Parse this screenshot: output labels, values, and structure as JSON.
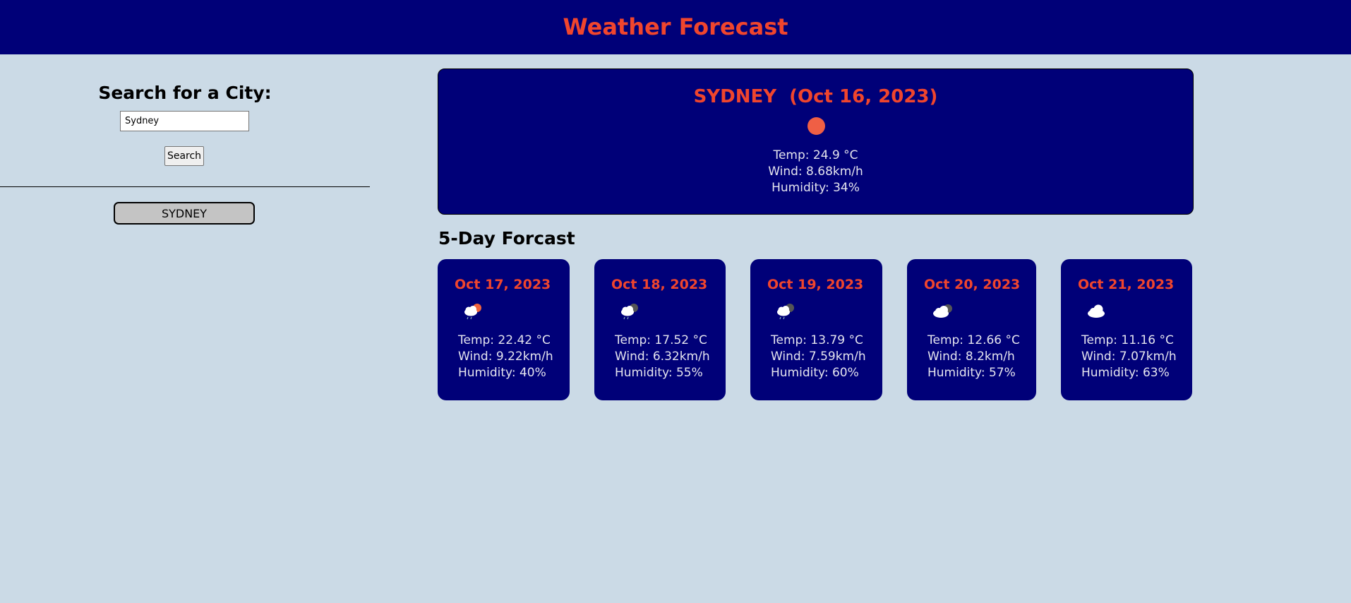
{
  "header": {
    "title": "Weather Forecast"
  },
  "sidebar": {
    "heading": "Search for a City:",
    "search_value": "Sydney",
    "search_button": "Search",
    "history": [
      "SYDNEY"
    ]
  },
  "current": {
    "title": "SYDNEY  (Oct 16, 2023)",
    "icon": "sun-icon",
    "temp": "Temp: 24.9 °C",
    "wind": "Wind: 8.68km/h",
    "humidity": "Humidity: 34%"
  },
  "forecast_heading": "5-Day Forcast",
  "forecast": [
    {
      "date": "Oct 17, 2023",
      "icon": "sun-behind-rain-cloud-icon",
      "temp": "Temp: 22.42 °C",
      "wind": "Wind: 9.22km/h",
      "humidity": "Humidity: 40%"
    },
    {
      "date": "Oct 18, 2023",
      "icon": "moon-behind-rain-cloud-icon",
      "temp": "Temp: 17.52 °C",
      "wind": "Wind: 6.32km/h",
      "humidity": "Humidity: 55%"
    },
    {
      "date": "Oct 19, 2023",
      "icon": "moon-behind-rain-cloud-icon",
      "temp": "Temp: 13.79 °C",
      "wind": "Wind: 7.59km/h",
      "humidity": "Humidity: 60%"
    },
    {
      "date": "Oct 20, 2023",
      "icon": "moon-behind-cloud-icon",
      "temp": "Temp: 12.66 °C",
      "wind": "Wind: 8.2km/h",
      "humidity": "Humidity: 57%"
    },
    {
      "date": "Oct 21, 2023",
      "icon": "cloud-icon",
      "temp": "Temp: 11.16 °C",
      "wind": "Wind: 7.07km/h",
      "humidity": "Humidity: 63%"
    }
  ],
  "colors": {
    "header_bg": "#000078",
    "accent": "#f0452d",
    "page_bg": "#cbdae6",
    "card_bg": "#000078"
  }
}
